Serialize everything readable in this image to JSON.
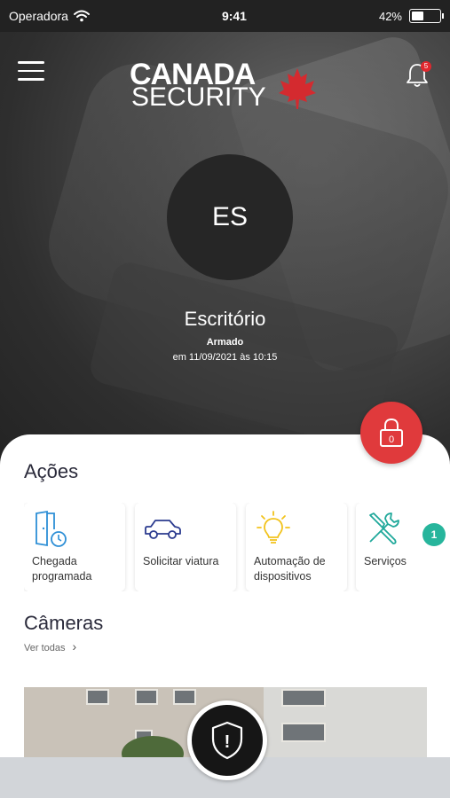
{
  "status_bar": {
    "carrier": "Operadora",
    "time": "9:41",
    "battery_label": "42%",
    "battery_level": 0.42
  },
  "header": {
    "logo_line1": "CANADA",
    "logo_line2": "SECURITY",
    "notification_count": "5"
  },
  "location": {
    "initials": "ES",
    "name": "Escritório",
    "status": "Armado",
    "updated": "em 11/09/2021 às 10:15"
  },
  "lock_button": {
    "icon": "lock-icon",
    "value": "0",
    "color": "#e03a3c"
  },
  "actions": {
    "title": "Ações",
    "items": [
      {
        "label": "Chegada programada",
        "icon": "door-clock-icon"
      },
      {
        "label": "Solicitar viatura",
        "icon": "car-icon"
      },
      {
        "label": "Automação de dispositivos",
        "icon": "lightbulb-icon"
      },
      {
        "label": "Serviços",
        "icon": "tools-icon"
      }
    ],
    "badge_count": "1",
    "badge_color": "#27b59c"
  },
  "cameras": {
    "title": "Câmeras",
    "see_all": "Ver todas",
    "see_all_chevron": "›"
  },
  "panic_button": {
    "icon": "shield-alert-icon",
    "symbol": "!"
  },
  "colors": {
    "accent_red": "#e03a3c",
    "icon_blue": "#2e8fd6",
    "car_blue": "#2b3b8f",
    "bulb_yellow": "#f2c31c",
    "tools_teal": "#1fa89a"
  }
}
